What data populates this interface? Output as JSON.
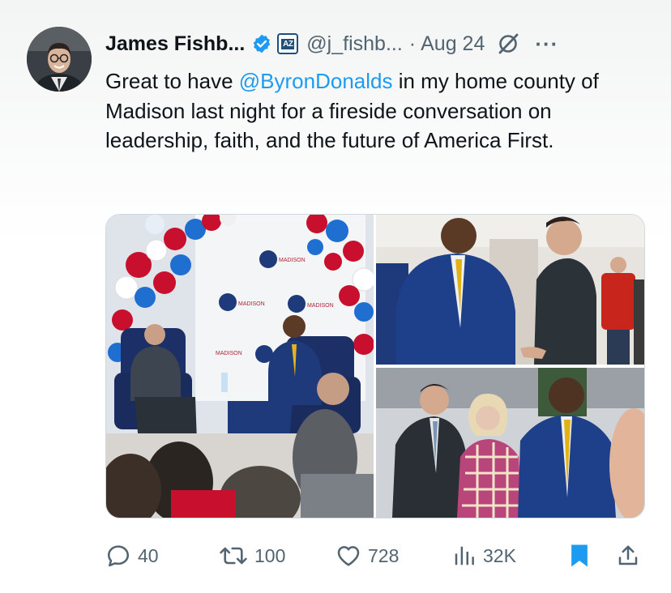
{
  "author": {
    "display_name": "James Fishb...",
    "handle": "@j_fishb...",
    "date": "Aug 24",
    "separator": "·",
    "badge_text": "AZ",
    "more_label": "···"
  },
  "tweet": {
    "text_before": "Great to have ",
    "mention": "@ByronDonalds",
    "text_after": " in my home county of Madison last night for a fireside conversation on leadership, faith, and the future of America First."
  },
  "media": {
    "banner_text": "MADISON",
    "photos": [
      "fireside-stage-photo",
      "handshake-photo",
      "group-photo"
    ]
  },
  "actions": {
    "replies": "40",
    "reposts": "100",
    "likes": "728",
    "views": "32K"
  },
  "colors": {
    "link": "#1d9bf0",
    "secondary_text": "#536471",
    "bookmark_active": "#1d9bf0",
    "verified": "#1d9bf0"
  },
  "icons": [
    "reply-icon",
    "repost-icon",
    "like-icon",
    "views-icon",
    "bookmark-icon",
    "share-icon",
    "verified-icon",
    "grok-icon",
    "more-icon"
  ]
}
